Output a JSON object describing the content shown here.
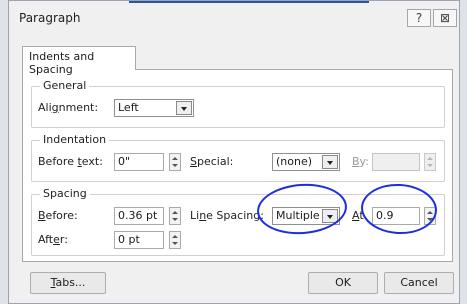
{
  "dialog": {
    "title": "Paragraph",
    "help_label": "?",
    "close_label": "⊠"
  },
  "tab": {
    "label": "Indents and Spacing"
  },
  "general": {
    "title": "General",
    "alignment_prefix": "Ali",
    "alignment_access": "g",
    "alignment_suffix": "nment:",
    "alignment_value": "Left"
  },
  "indentation": {
    "title": "Indentation",
    "before_text_prefix": "Before ",
    "before_text_access": "t",
    "before_text_suffix": "ext:",
    "before_text_value": "0\"",
    "special_access": "S",
    "special_suffix": "pecial:",
    "special_value": "(none)",
    "by_access": "B",
    "by_suffix": "y:",
    "by_value": ""
  },
  "spacing": {
    "title": "Spacing",
    "before_access": "B",
    "before_suffix": "efore:",
    "before_value": "0.36 pt",
    "after_prefix": "Aft",
    "after_access": "e",
    "after_suffix": "r:",
    "after_value": "0 pt",
    "line_spacing_prefix": "Li",
    "line_spacing_access": "n",
    "line_spacing_suffix": "e Spacing:",
    "line_spacing_value": "Multiple",
    "at_access": "A",
    "at_suffix": "t",
    "at_value": "0.9"
  },
  "buttons": {
    "tabs_access": "T",
    "tabs_suffix": "abs...",
    "ok_label": "OK",
    "cancel_label": "Cancel"
  },
  "annotation_color": "#1c2ee0"
}
